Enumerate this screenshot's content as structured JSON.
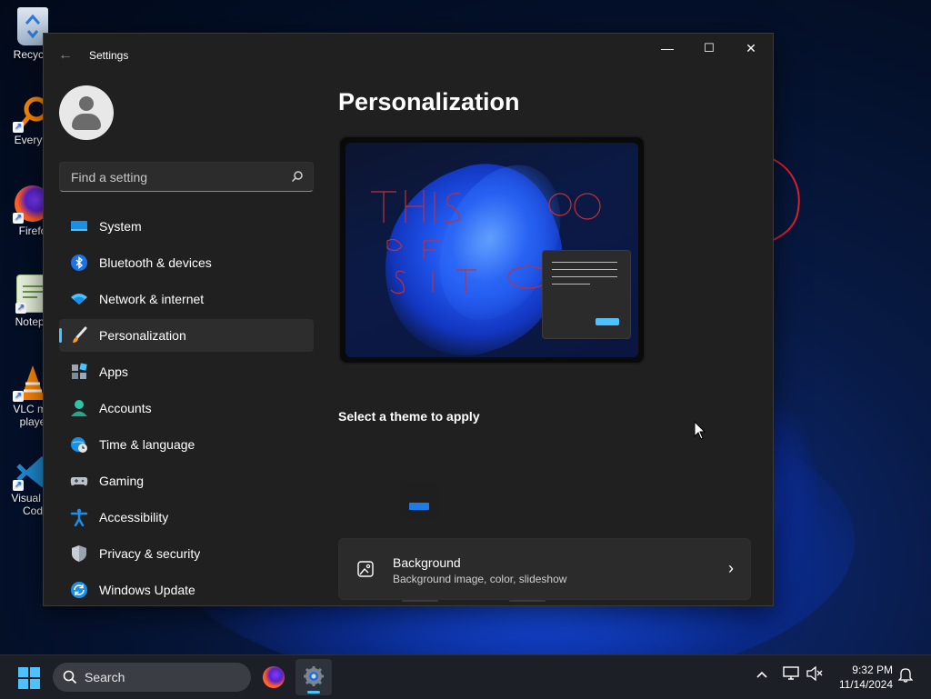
{
  "desktop": {
    "icons": [
      {
        "label": "Recycle",
        "icon": "recycle-bin-icon"
      },
      {
        "label": "Everyth",
        "icon": "everything-search-icon"
      },
      {
        "label": "Firefo",
        "icon": "firefox-icon"
      },
      {
        "label": "Notepa",
        "icon": "notepad-icon"
      },
      {
        "label": "VLC me\nplaye",
        "icon": "vlc-icon"
      },
      {
        "label": "Visual St\nCod",
        "icon": "vscode-icon"
      }
    ]
  },
  "window": {
    "title": "Settings",
    "controls": {
      "minimize": "—",
      "maximize": "☐",
      "close": "✕"
    }
  },
  "search": {
    "placeholder": "Find a setting"
  },
  "nav": {
    "items": [
      {
        "label": "System",
        "icon": "system-display-icon"
      },
      {
        "label": "Bluetooth & devices",
        "icon": "bluetooth-icon"
      },
      {
        "label": "Network & internet",
        "icon": "wifi-icon"
      },
      {
        "label": "Personalization",
        "icon": "paintbrush-icon",
        "active": true
      },
      {
        "label": "Apps",
        "icon": "apps-icon"
      },
      {
        "label": "Accounts",
        "icon": "account-icon"
      },
      {
        "label": "Time & language",
        "icon": "globe-clock-icon"
      },
      {
        "label": "Gaming",
        "icon": "gamepad-icon"
      },
      {
        "label": "Accessibility",
        "icon": "accessibility-icon"
      },
      {
        "label": "Privacy & security",
        "icon": "shield-icon"
      },
      {
        "label": "Windows Update",
        "icon": "update-icon"
      }
    ]
  },
  "main": {
    "title": "Personalization",
    "theme_section_label": "Select a theme to apply",
    "background_card": {
      "title": "Background",
      "subtitle": "Background image, color, slideshow",
      "chevron": "›"
    }
  },
  "taskbar": {
    "search_label": "Search",
    "clock_time": "9:32 PM",
    "clock_date": "11/14/2024",
    "tray_chevron": "^"
  },
  "colors": {
    "accent": "#4cc2ff",
    "window_bg": "#202020",
    "card_bg": "#2b2b2b",
    "annotation_red": "#e0202a"
  }
}
